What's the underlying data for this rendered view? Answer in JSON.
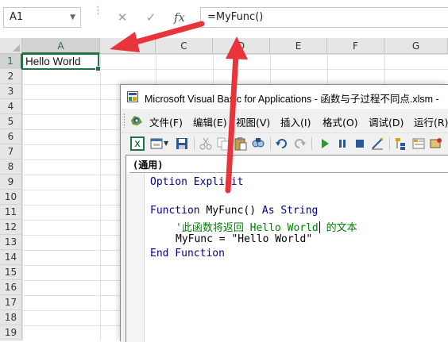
{
  "formula_bar": {
    "name_box": "A1",
    "cancel_icon": "✕",
    "enter_icon": "✓",
    "fx_label": "fx",
    "formula": "=MyFunc()"
  },
  "grid": {
    "columns": [
      "A",
      "B",
      "C",
      "D",
      "E",
      "F",
      "G"
    ],
    "rows": [
      "1",
      "2",
      "3",
      "4",
      "5",
      "6",
      "7",
      "8",
      "9",
      "10",
      "11",
      "12",
      "13",
      "14",
      "15",
      "16",
      "17",
      "18",
      "19"
    ],
    "selected_cell": "A1",
    "a1_value": "Hello World"
  },
  "vba": {
    "title": "Microsoft Visual Basic for Applications - 函数与子过程不同点.xlsm -",
    "menu": [
      "文件(F)",
      "编辑(E)",
      "视图(V)",
      "插入(I)",
      "格式(O)",
      "调试(D)",
      "运行(R)"
    ],
    "proc_dropdown": "(通用)",
    "code": {
      "line1_kw": "Option Explicit",
      "line2_kw": "Function",
      "line2_tx": " MyFunc() ",
      "line2_kw2": "As String",
      "line3_comment_a": "'此函数将返回 Hello World",
      "line3_comment_b": " 的文本",
      "line4_tx": "MyFunc = \"Hello World\"",
      "line5_kw": "End Function"
    }
  },
  "colors": {
    "excel_green": "#217346",
    "annotation_red": "#e8343a",
    "vba_keyword": "#00008b",
    "vba_comment": "#008000"
  }
}
